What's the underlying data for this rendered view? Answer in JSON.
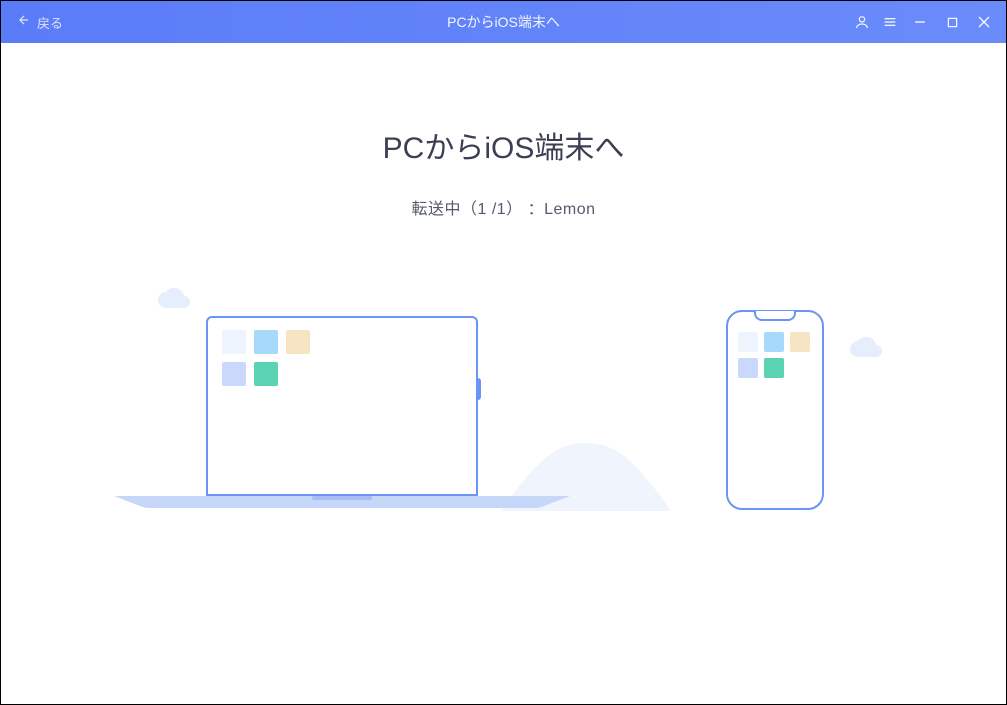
{
  "titlebar": {
    "back_label": "戻る",
    "title": "PCからiOS端末へ"
  },
  "main": {
    "heading": "PCからiOS端末へ",
    "status_prefix": "転送中（",
    "status_current": "1",
    "status_sep": " /",
    "status_total": "1",
    "status_suffix": "） ：",
    "status_filename": "Lemon"
  },
  "colors": {
    "accent": "#6b95f3",
    "titlebar_start": "#5a7cf8",
    "titlebar_end": "#6a8bfa"
  }
}
